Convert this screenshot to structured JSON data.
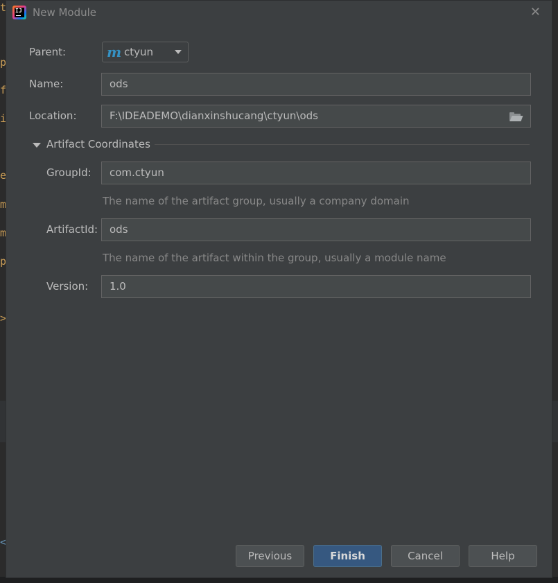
{
  "background": {
    "editor_chars": [
      "t",
      "p",
      "f",
      "i",
      "e",
      "m",
      "m",
      "p",
      ">",
      "<"
    ]
  },
  "dialog": {
    "title": "New Module",
    "app_icon_text": "IJ"
  },
  "form": {
    "parent_label": "Parent:",
    "parent_value": "ctyun",
    "name_label": "Name:",
    "name_value": "ods",
    "location_label": "Location:",
    "location_value": "F:\\IDEADEMO\\dianxinshucang\\ctyun\\ods"
  },
  "artifact": {
    "section_label": "Artifact Coordinates",
    "groupid_label": "GroupId:",
    "groupid_value": "com.ctyun",
    "groupid_hint": "The name of the artifact group, usually a company domain",
    "artifactid_label": "ArtifactId:",
    "artifactid_value": "ods",
    "artifactid_hint": "The name of the artifact within the group, usually a module name",
    "version_label": "Version:",
    "version_value": "1.0"
  },
  "buttons": {
    "previous": "Previous",
    "finish": "Finish",
    "cancel": "Cancel",
    "help": "Help"
  },
  "colors": {
    "dialog_bg": "#3c3f41",
    "field_bg": "#45494a",
    "primary_button": "#365880",
    "maven_icon": "#3592c4"
  }
}
